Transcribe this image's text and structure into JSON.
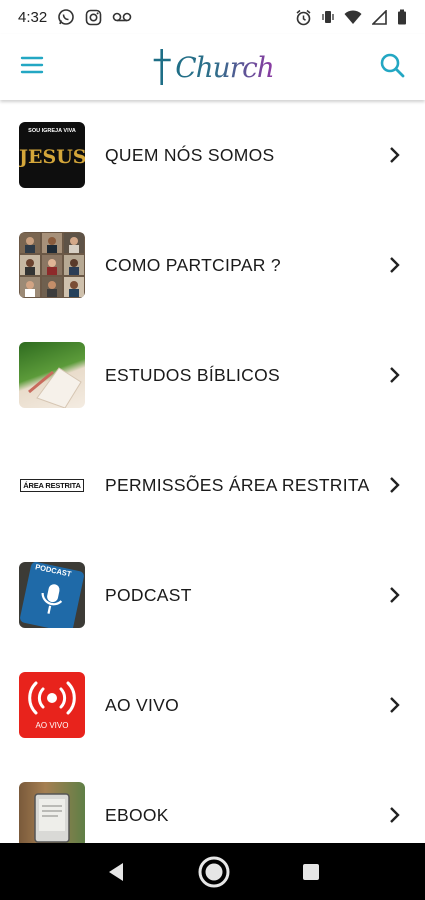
{
  "status": {
    "time": "4:32"
  },
  "header": {
    "logo_text": "Church"
  },
  "menu": [
    {
      "label": "QUEM NÓS SOMOS",
      "thumb_caption": "SOU IGREJA VIVA",
      "thumb_title": "JESUS"
    },
    {
      "label": "COMO PARTCIPAR ?"
    },
    {
      "label": "ESTUDOS BÍBLICOS"
    },
    {
      "label": "PERMISSÕES ÁREA RESTRITA",
      "thumb_title": "ÁREA RESTRITA"
    },
    {
      "label": "PODCAST",
      "thumb_title": "PODCAST"
    },
    {
      "label": "AO VIVO",
      "thumb_title": "AO VIVO"
    },
    {
      "label": "EBOOK"
    }
  ],
  "colors": {
    "accent": "#23a7c3",
    "live_red": "#e8231c",
    "podcast_blue": "#1f6aa8"
  }
}
